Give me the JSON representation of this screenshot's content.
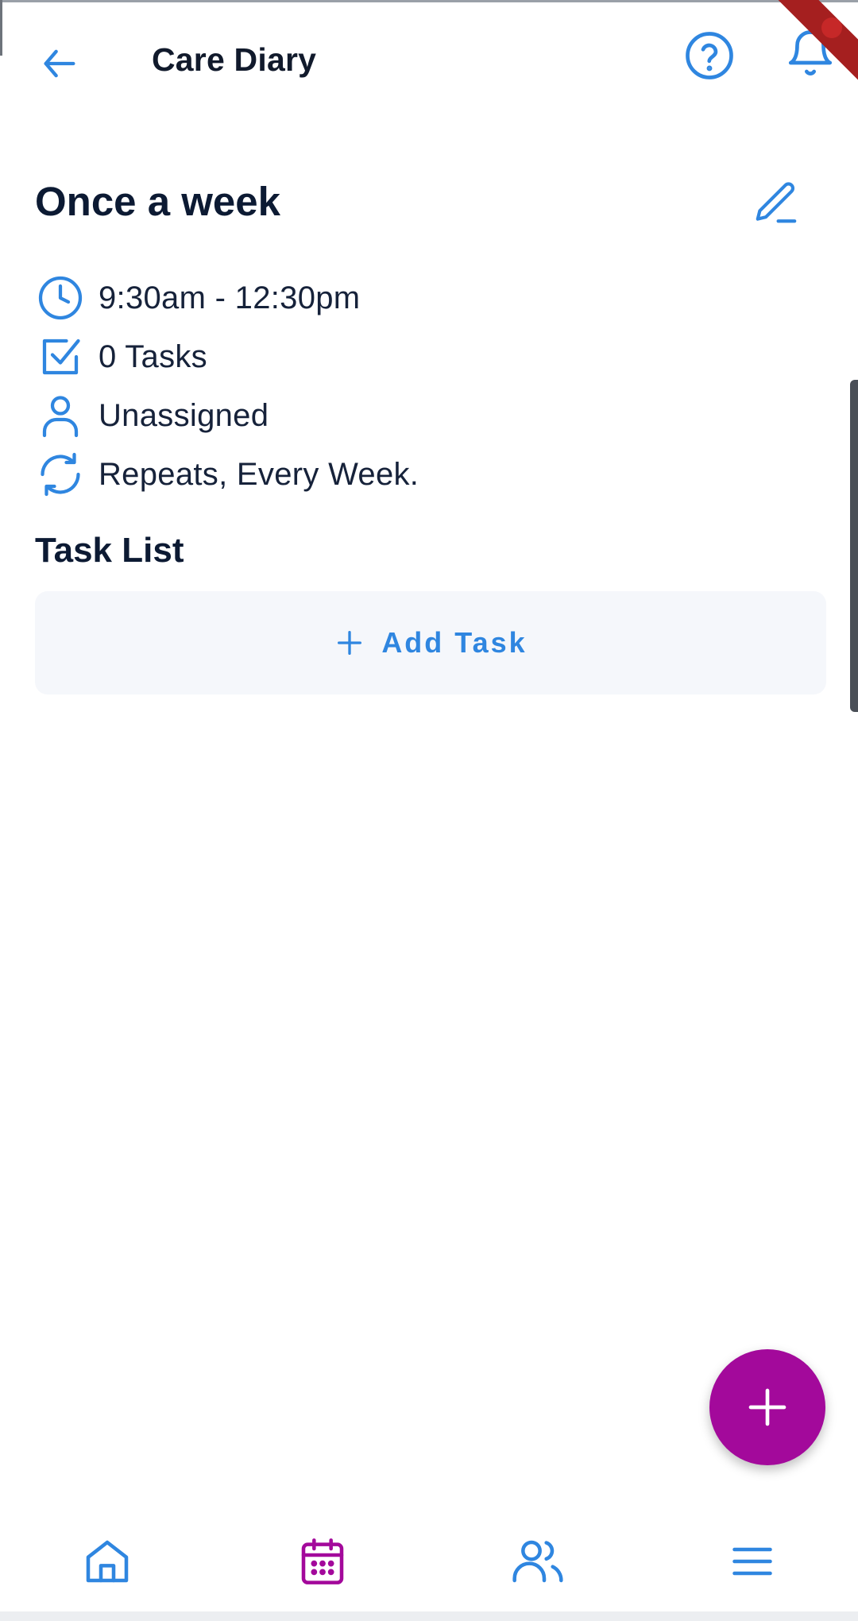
{
  "appbar": {
    "title": "Care Diary",
    "back_icon": "arrow-left-icon",
    "help_icon": "help-circle-icon",
    "notifications_icon": "bell-icon"
  },
  "event": {
    "title": "Once a week",
    "edit_icon": "pencil-icon",
    "details": [
      {
        "icon": "clock-icon",
        "text": "9:30am - 12:30pm"
      },
      {
        "icon": "checkbox-icon",
        "text": "0 Tasks"
      },
      {
        "icon": "user-icon",
        "text": "Unassigned"
      },
      {
        "icon": "repeat-icon",
        "text": "Repeats, Every Week."
      }
    ]
  },
  "task_list": {
    "heading": "Task List",
    "add_label": "Add Task",
    "add_icon": "plus-icon"
  },
  "fab": {
    "icon": "plus-icon"
  },
  "bottom_nav": {
    "items": [
      {
        "icon": "home-icon",
        "active": false
      },
      {
        "icon": "calendar-icon",
        "active": true
      },
      {
        "icon": "people-icon",
        "active": false
      },
      {
        "icon": "menu-icon",
        "active": false
      }
    ]
  },
  "colors": {
    "accent": "#2f86e0",
    "brand_magenta": "#a3099b",
    "text_dark": "#0c1a33",
    "card_bg": "#f5f7fb"
  }
}
